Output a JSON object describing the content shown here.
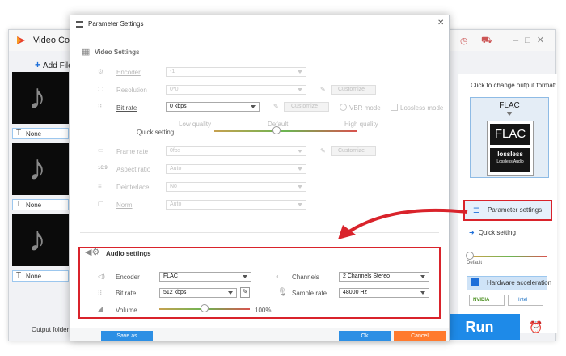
{
  "app": {
    "title": "Video Conv",
    "add_files": "Add File",
    "output_folder_label": "Output folder:",
    "run_label": "Run"
  },
  "files": [
    {
      "subtitle": "None"
    },
    {
      "subtitle": "None"
    },
    {
      "subtitle": "None"
    }
  ],
  "right_panel": {
    "change_format_label": "Click to change output format:",
    "format_name": "FLAC",
    "format_icon_top": "FLAC",
    "format_icon_bottom": "lossless",
    "format_icon_caption": "Lossless Audio",
    "parameter_settings_label": "Parameter settings",
    "quick_setting_label": "Quick setting",
    "slider_default_label": "Default",
    "hardware_accel_label": "Hardware acceleration",
    "nvidia_label": "NVIDIA",
    "intel_label": "Intel",
    "colors": {
      "accent": "#1e8ae8",
      "highlight_border": "#d9232b"
    }
  },
  "dialog": {
    "title": "Parameter Settings",
    "video_section": "Video Settings",
    "audio_section": "Audio settings",
    "video": {
      "encoder": {
        "label": "Encoder",
        "value": "-1"
      },
      "resolution": {
        "label": "Resolution",
        "value": "0*0",
        "customize": "Customize"
      },
      "bitrate": {
        "label": "Bit rate",
        "value": "0 kbps",
        "customize": "Customize",
        "vbr": "VBR mode",
        "lossless": "Lossless mode"
      },
      "quick_setting": {
        "label": "Quick setting",
        "low": "Low quality",
        "default": "Default",
        "high": "High quality"
      },
      "frame_rate": {
        "label": "Frame rate",
        "value": "0fps",
        "customize": "Customize"
      },
      "aspect_ratio": {
        "label": "Aspect ratio",
        "value": "Auto"
      },
      "deinterlace": {
        "label": "Deinterlace",
        "value": "No"
      },
      "norm": {
        "label": "Norm",
        "value": "Auto"
      }
    },
    "audio": {
      "encoder": {
        "label": "Encoder",
        "value": "FLAC"
      },
      "bitrate": {
        "label": "Bit rate",
        "value": "512 kbps"
      },
      "volume": {
        "label": "Volume",
        "value": "100%",
        "level": 0.5
      },
      "channels": {
        "label": "Channels",
        "value": "2 Channels Stereo"
      },
      "sample_rate": {
        "label": "Sample rate",
        "value": "48000 Hz"
      }
    },
    "buttons": {
      "save_as": "Save as",
      "ok": "Ok",
      "cancel": "Cancel"
    }
  }
}
